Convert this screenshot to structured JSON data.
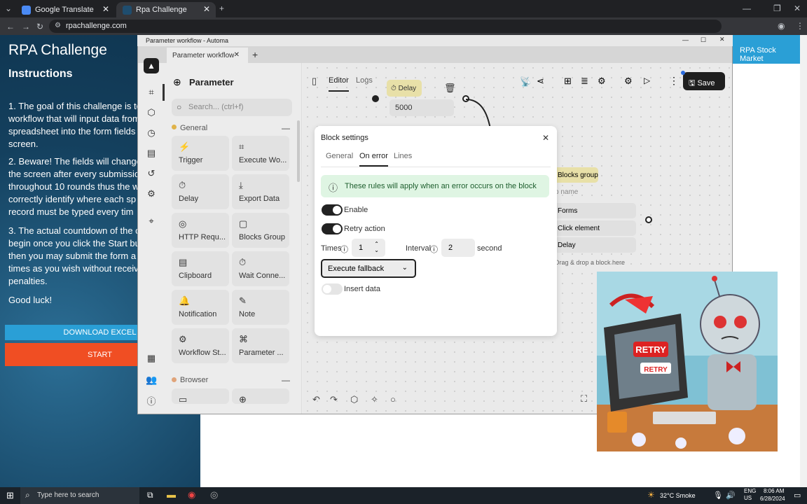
{
  "browser": {
    "tabs": [
      {
        "label": "Google Translate",
        "active": false
      },
      {
        "label": "Rpa Challenge",
        "active": true
      }
    ],
    "url": "rpachallenge.com"
  },
  "rpa_page": {
    "title": "RPA Challenge",
    "instructions_heading": "Instructions",
    "p1": [
      "1. The goal of this challenge is to",
      "workflow that will input data from",
      "spreadsheet into the form fields",
      "screen."
    ],
    "p2": [
      "2. Beware! The fields will change",
      "the screen after every submissio",
      "throughout 10 rounds thus the w",
      "correctly identify where each sp",
      "record must be typed every tim"
    ],
    "p3": [
      "3. The actual countdown of the c",
      "begin once you click the Start bu",
      "then you may submit the form a",
      "times as you wish without receiv",
      "penalties."
    ],
    "good_luck": "Good luck!",
    "download_btn": "DOWNLOAD EXCEL",
    "start_btn": "START",
    "stock_link": "RPA Stock Market"
  },
  "automa": {
    "window_title": "Parameter workflow - Automa",
    "tab_label": "Parameter workflow",
    "panel": {
      "title": "Parameter",
      "search_placeholder": "Search... (ctrl+f)",
      "section_general": "General",
      "section_browser": "Browser",
      "blocks": [
        {
          "label": "Trigger",
          "icon": "⚡"
        },
        {
          "label": "Execute Wo...",
          "icon": "⌗"
        },
        {
          "label": "Delay",
          "icon": "⏱"
        },
        {
          "label": "Export Data",
          "icon": "⤓"
        },
        {
          "label": "HTTP Requ...",
          "icon": "◎"
        },
        {
          "label": "Blocks Group",
          "icon": "▢"
        },
        {
          "label": "Clipboard",
          "icon": "▤"
        },
        {
          "label": "Wait Conne...",
          "icon": "⏱"
        },
        {
          "label": "Notification",
          "icon": "🔔"
        },
        {
          "label": "Note",
          "icon": "✎"
        },
        {
          "label": "Workflow St...",
          "icon": "⚙"
        },
        {
          "label": "Parameter ...",
          "icon": "⌘"
        }
      ]
    },
    "toolbar": {
      "editor_tab": "Editor",
      "logs_tab": "Logs",
      "save_btn": "Save"
    },
    "canvas": {
      "delay_node_label": "Delay",
      "delay_value": "5000",
      "group_label": "Blocks group",
      "group_name_placeholder": "p name",
      "group_items": [
        "Forms",
        "Click element",
        "Delay"
      ],
      "drop_hint": "Drag & drop a block here"
    },
    "dialog": {
      "title": "Block settings",
      "tabs": [
        "General",
        "On error",
        "Lines"
      ],
      "active_tab": "On error",
      "alert": "These rules will apply when an error occurs on the block",
      "enable_label": "Enable",
      "retry_label": "Retry action",
      "times_label": "Times",
      "times_value": "1",
      "interval_label": "Interval",
      "interval_value": "2",
      "interval_unit": "second",
      "fallback_select": "Execute fallback",
      "insert_label": "Insert data"
    }
  },
  "taskbar": {
    "search_placeholder": "Type here to search",
    "weather": "32°C  Smoke",
    "lang": "ENG\nUS",
    "time": "8:06 AM",
    "date": "6/28/2024"
  },
  "colors": {
    "accent_blue": "#2a9fd6",
    "start_red": "#f04e23",
    "automa_dark": "#1f1f1f",
    "success_bg": "#dff5e3"
  }
}
